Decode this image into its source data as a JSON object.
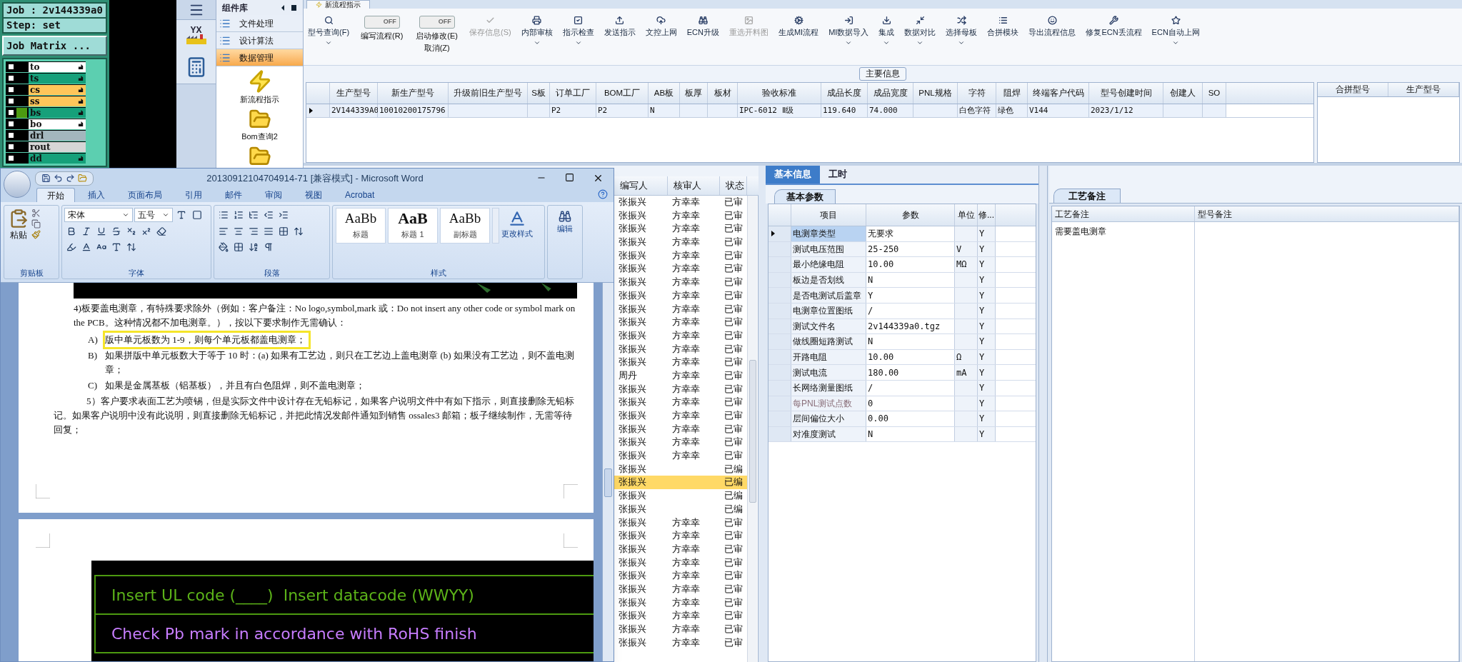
{
  "job_panel": {
    "job": "Job : 2v144339a0",
    "step": "Step: set",
    "matrix_button": "Job Matrix ...",
    "layers": [
      {
        "name": "to",
        "color": "#ffffff",
        "checked": false,
        "affected": false,
        "pointer": true
      },
      {
        "name": "ts",
        "color": "#16a07a",
        "checked": false,
        "affected": false,
        "pointer": true
      },
      {
        "name": "cs",
        "color": "#ffc65a",
        "checked": false,
        "affected": false,
        "pointer": true
      },
      {
        "name": "ss",
        "color": "#ffc65a",
        "checked": false,
        "affected": false,
        "pointer": true
      },
      {
        "name": "bs",
        "color": "#16a07a",
        "checked": false,
        "affected": true,
        "pointer": true
      },
      {
        "name": "bo",
        "color": "#ffffff",
        "checked": false,
        "affected": false,
        "pointer": true
      },
      {
        "name": "drl",
        "color": "#a3b6bd",
        "checked": false,
        "affected": false,
        "pointer": false
      },
      {
        "name": "rout",
        "color": "#d6d6d6",
        "checked": false,
        "affected": false,
        "pointer": false
      },
      {
        "name": "dd",
        "color": "#16a07a",
        "checked": false,
        "affected": false,
        "pointer": true
      }
    ]
  },
  "side_strip": {
    "logo_text": "YX"
  },
  "component_library": {
    "title": "组件库",
    "categories": [
      {
        "label": "文件处理",
        "selected": false
      },
      {
        "label": "设计算法",
        "selected": false
      },
      {
        "label": "数据管理",
        "selected": true
      }
    ],
    "items": [
      {
        "kind": "lightning",
        "label": "新流程指示"
      },
      {
        "kind": "folder",
        "label": "Bom查询2"
      },
      {
        "kind": "folder"
      }
    ]
  },
  "document_tab": {
    "label": "新流程指示"
  },
  "toolbar": [
    {
      "kind": "button",
      "label": "型号查询(F)",
      "menu": true,
      "disabled": false
    },
    {
      "kind": "toggle",
      "switch_text": "OFF",
      "on": false,
      "label": "编写流程(R)"
    },
    {
      "kind": "toggle",
      "switch_text": "OFF",
      "on": false,
      "label": "启动修改(E)",
      "sub_label": "取消(Z)"
    },
    {
      "kind": "button",
      "label": "保存信息(S)",
      "menu": false,
      "disabled": true
    },
    {
      "kind": "button",
      "label": "内部审核",
      "menu": true,
      "disabled": false
    },
    {
      "kind": "button",
      "label": "指示检查",
      "menu": true,
      "disabled": false
    },
    {
      "kind": "button",
      "label": "发送指示",
      "menu": false,
      "disabled": false
    },
    {
      "kind": "button",
      "label": "文控上网",
      "menu": false,
      "disabled": false
    },
    {
      "kind": "button",
      "label": "ECN升级",
      "menu": false,
      "disabled": false
    },
    {
      "kind": "button",
      "label": "重选开料图",
      "menu": false,
      "disabled": true
    },
    {
      "kind": "button",
      "label": "生成MI流程",
      "menu": false,
      "disabled": false
    },
    {
      "kind": "button",
      "label": "MI数据导入",
      "menu": true,
      "disabled": false
    },
    {
      "kind": "button",
      "label": "集成",
      "menu": true,
      "disabled": false
    },
    {
      "kind": "button",
      "label": "数据对比",
      "menu": true,
      "disabled": false
    },
    {
      "kind": "button",
      "label": "选择母板",
      "menu": true,
      "disabled": false
    },
    {
      "kind": "button",
      "label": "合拼模块",
      "menu": false,
      "disabled": false
    },
    {
      "kind": "button",
      "label": "导出流程信息",
      "menu": false,
      "disabled": false
    },
    {
      "kind": "button",
      "label": "修复ECN丢流程",
      "menu": false,
      "disabled": false
    },
    {
      "kind": "button",
      "label": "ECN自动上网",
      "menu": true,
      "disabled": false
    }
  ],
  "main_info": {
    "title": "主要信息",
    "columns": [
      "生产型号",
      "新生产型号",
      "升级前旧生产型号",
      "S板",
      "订单工厂",
      "BOM工厂",
      "AB板",
      "板厚",
      "板材",
      "验收标准",
      "成品长度",
      "成品宽度",
      "PNL规格",
      "字符",
      "阻焊",
      "终端客户代码",
      "型号创建时间",
      "创建人",
      "SO"
    ],
    "rows": [
      {
        "selected": true,
        "cells": [
          "2V144339A0",
          "10010200175796",
          "",
          "",
          "P2",
          "P2",
          "N",
          "",
          "",
          "IPC-6012 Ⅱ级",
          "119.640",
          "74.000",
          "",
          "白色字符",
          "绿色",
          "V144",
          "2023/1/12",
          "",
          ""
        ]
      }
    ]
  },
  "merge_table": {
    "columns": [
      "合拼型号",
      "生产型号"
    ]
  },
  "flow_list": {
    "columns": [
      "编写人",
      "核审人",
      "状态"
    ],
    "rows": [
      {
        "cells": [
          "张振兴",
          "方幸幸",
          "已审"
        ],
        "selected": false
      },
      {
        "cells": [
          "张振兴",
          "方幸幸",
          "已审"
        ],
        "selected": false
      },
      {
        "cells": [
          "张振兴",
          "方幸幸",
          "已审"
        ],
        "selected": false
      },
      {
        "cells": [
          "张振兴",
          "方幸幸",
          "已审"
        ],
        "selected": false
      },
      {
        "cells": [
          "张振兴",
          "方幸幸",
          "已审"
        ],
        "selected": false
      },
      {
        "cells": [
          "张振兴",
          "方幸幸",
          "已审"
        ],
        "selected": false
      },
      {
        "cells": [
          "张振兴",
          "方幸幸",
          "已审"
        ],
        "selected": false
      },
      {
        "cells": [
          "张振兴",
          "方幸幸",
          "已审"
        ],
        "selected": false
      },
      {
        "cells": [
          "张振兴",
          "方幸幸",
          "已审"
        ],
        "selected": false
      },
      {
        "cells": [
          "张振兴",
          "方幸幸",
          "已审"
        ],
        "selected": false
      },
      {
        "cells": [
          "张振兴",
          "方幸幸",
          "已审"
        ],
        "selected": false
      },
      {
        "cells": [
          "张振兴",
          "方幸幸",
          "已审"
        ],
        "selected": false
      },
      {
        "cells": [
          "张振兴",
          "方幸幸",
          "已审"
        ],
        "selected": false
      },
      {
        "cells": [
          "周丹",
          "方幸幸",
          "已审"
        ],
        "selected": false
      },
      {
        "cells": [
          "张振兴",
          "方幸幸",
          "已审"
        ],
        "selected": false
      },
      {
        "cells": [
          "张振兴",
          "方幸幸",
          "已审"
        ],
        "selected": false
      },
      {
        "cells": [
          "张振兴",
          "方幸幸",
          "已审"
        ],
        "selected": false
      },
      {
        "cells": [
          "张振兴",
          "方幸幸",
          "已审"
        ],
        "selected": false
      },
      {
        "cells": [
          "张振兴",
          "方幸幸",
          "已审"
        ],
        "selected": false
      },
      {
        "cells": [
          "张振兴",
          "方幸幸",
          "已审"
        ],
        "selected": false
      },
      {
        "cells": [
          "张振兴",
          "",
          "已编"
        ],
        "selected": false
      },
      {
        "cells": [
          "张振兴",
          "",
          "已编"
        ],
        "selected": true
      },
      {
        "cells": [
          "张振兴",
          "",
          "已编"
        ],
        "selected": false
      },
      {
        "cells": [
          "张振兴",
          "",
          "已编"
        ],
        "selected": false
      },
      {
        "cells": [
          "张振兴",
          "方幸幸",
          "已审"
        ],
        "selected": false
      },
      {
        "cells": [
          "张振兴",
          "方幸幸",
          "已审"
        ],
        "selected": false
      },
      {
        "cells": [
          "张振兴",
          "方幸幸",
          "已审"
        ],
        "selected": false
      },
      {
        "cells": [
          "张振兴",
          "方幸幸",
          "已审"
        ],
        "selected": false
      },
      {
        "cells": [
          "张振兴",
          "方幸幸",
          "已审"
        ],
        "selected": false
      },
      {
        "cells": [
          "张振兴",
          "方幸幸",
          "已审"
        ],
        "selected": false
      },
      {
        "cells": [
          "张振兴",
          "方幸幸",
          "已审"
        ],
        "selected": false
      },
      {
        "cells": [
          "张振兴",
          "方幸幸",
          "已审"
        ],
        "selected": false
      },
      {
        "cells": [
          "张振兴",
          "方幸幸",
          "已审"
        ],
        "selected": false
      },
      {
        "cells": [
          "张振兴",
          "方幸幸",
          "已审"
        ],
        "selected": false
      }
    ]
  },
  "basic_info": {
    "tabs": [
      {
        "label": "基本信息",
        "selected": true
      },
      {
        "label": "工时",
        "selected": false
      }
    ],
    "subtab": "基本参数",
    "columns": [
      "项目",
      "参数",
      "单位",
      "修..."
    ],
    "rows": [
      {
        "cells": [
          "电测章类型",
          "无要求",
          "",
          "Y"
        ],
        "selected": true,
        "disabled": false
      },
      {
        "cells": [
          "测试电压范围",
          "25-250",
          "V",
          "Y"
        ],
        "selected": false,
        "disabled": false
      },
      {
        "cells": [
          "最小绝缘电阻",
          "10.00",
          "MΩ",
          "Y"
        ],
        "selected": false,
        "disabled": false
      },
      {
        "cells": [
          "板边是否划线",
          "N",
          "",
          "Y"
        ],
        "selected": false,
        "disabled": false
      },
      {
        "cells": [
          "是否电测试后盖章",
          "Y",
          "",
          "Y"
        ],
        "selected": false,
        "disabled": false
      },
      {
        "cells": [
          "电测章位置图纸",
          "/",
          "",
          "Y"
        ],
        "selected": false,
        "disabled": false
      },
      {
        "cells": [
          "测试文件名",
          "2v144339a0.tgz",
          "",
          "Y"
        ],
        "selected": false,
        "disabled": false
      },
      {
        "cells": [
          "做线圈短路测试",
          "N",
          "",
          "Y"
        ],
        "selected": false,
        "disabled": false
      },
      {
        "cells": [
          "开路电阻",
          "10.00",
          "Ω",
          "Y"
        ],
        "selected": false,
        "disabled": false
      },
      {
        "cells": [
          "测试电流",
          "180.00",
          "mA",
          "Y"
        ],
        "selected": false,
        "disabled": false
      },
      {
        "cells": [
          "长网络测量图纸",
          "/",
          "",
          "Y"
        ],
        "selected": false,
        "disabled": false
      },
      {
        "cells": [
          "每PNL测试点数",
          "0",
          "",
          "Y"
        ],
        "selected": false,
        "disabled": true
      },
      {
        "cells": [
          "层间偏位大小",
          "0.00",
          "",
          "Y"
        ],
        "selected": false,
        "disabled": false
      },
      {
        "cells": [
          "对准度测试",
          "N",
          "",
          "Y"
        ],
        "selected": false,
        "disabled": false
      }
    ]
  },
  "process_notes": {
    "tab": "工艺备注",
    "columns": [
      "工艺备注",
      "型号备注"
    ],
    "rows": [
      [
        "需要盖电测章",
        ""
      ]
    ]
  },
  "word": {
    "title": "20130912104704914-71 [兼容模式] - Microsoft Word",
    "tabs": [
      {
        "label": "开始",
        "selected": true
      },
      {
        "label": "插入",
        "selected": false
      },
      {
        "label": "页面布局",
        "selected": false
      },
      {
        "label": "引用",
        "selected": false
      },
      {
        "label": "邮件",
        "selected": false
      },
      {
        "label": "审阅",
        "selected": false
      },
      {
        "label": "视图",
        "selected": false
      },
      {
        "label": "Acrobat",
        "selected": false
      }
    ],
    "paste": "粘贴",
    "font_name": "宋体",
    "font_size": "五号",
    "styles": [
      {
        "preview": "AaBb",
        "label": "标题"
      },
      {
        "preview": "AaB",
        "label": "标题 1"
      },
      {
        "preview": "AaBb",
        "label": "副标题"
      }
    ],
    "change_styles": "更改样式",
    "editing": "编辑",
    "groups": [
      "剪贴板",
      "字体",
      "段落",
      "样式"
    ],
    "paragraphs": [
      {
        "kind": "block",
        "text": "4)板要盖电测章，有特殊要求除外（例如：客户备注：No logo,symbol,mark 或：Do not insert any other code or symbol mark on the PCB。这种情况都不加电测章。），按以下要求制作无需确认：",
        "highlighted": false
      },
      {
        "kind": "item",
        "marker": "A)",
        "text": "版中单元板数为 1-9，则每个单元板都盖电测章；",
        "highlighted": true
      },
      {
        "kind": "item",
        "marker": "B)",
        "text": "如果拼版中单元板数大于等于 10 时：(a) 如果有工艺边，则只在工艺边上盖电测章 (b) 如果没有工艺边，则不盖电测章；",
        "highlighted": false
      },
      {
        "kind": "item",
        "marker": "C)",
        "text": "如果是金属基板（铝基板），并且有白色阻焊，则不盖电测章；",
        "highlighted": false
      },
      {
        "kind": "body",
        "text": "5）客户要求表面工艺为喷锡，但是实际文件中设计存在无铅标记，如果客户说明文件中有如下指示，则直接删除无铅标记。如果客户说明中没有此说明，则直接删除无铅标记，并把此情况发邮件通知到销售 ossales3 邮箱；板子继续制作，无需等待回复；",
        "highlighted": false
      }
    ],
    "page2_lines": [
      {
        "text": "Insert UL code (____)  Insert datacode (WWYY)",
        "color": "#5cb319"
      },
      {
        "text": "Check Pb mark in accordance with RoHS finish",
        "color": "#c77dff"
      }
    ]
  }
}
